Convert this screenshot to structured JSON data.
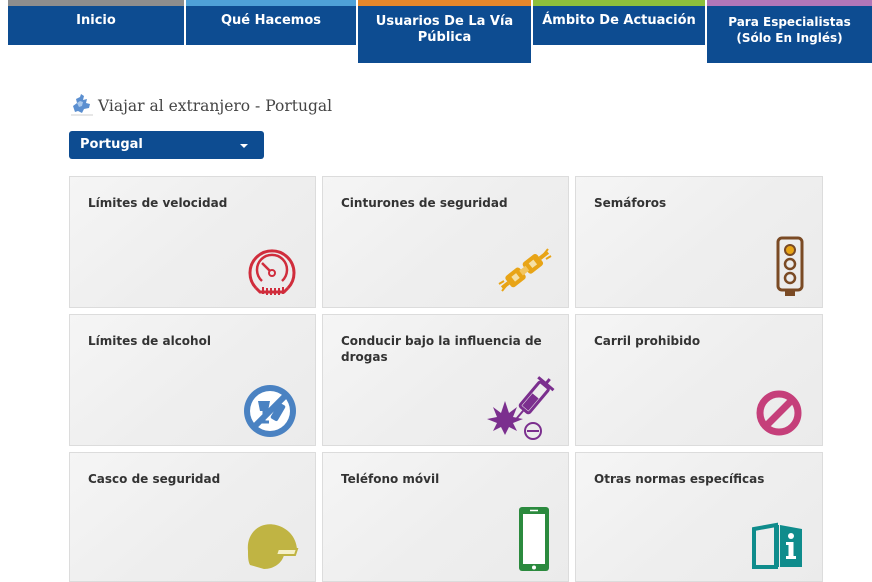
{
  "nav": {
    "tabs": [
      {
        "label": "Inicio",
        "stripe_color": "#8d8d8d"
      },
      {
        "label": "Qué Hacemos",
        "stripe_color": "#4ea1d8"
      },
      {
        "label": "Usuarios De La Vía Pública",
        "stripe_color": "#e5872b"
      },
      {
        "label": "Ámbito De Actuación",
        "stripe_color": "#8dbf3c"
      },
      {
        "label": "Para Especialistas (Sólo En Inglés)",
        "stripe_color": "#b276b8"
      }
    ]
  },
  "heading": {
    "text": "Viajar al extranjero - Portugal",
    "icon": "europe-map-icon"
  },
  "country_select": {
    "value": "Portugal"
  },
  "tiles": [
    {
      "title": "Límites de velocidad",
      "icon": "speedometer-icon",
      "color": "#d02d3c"
    },
    {
      "title": "Cinturones de seguridad",
      "icon": "seatbelt-buckle-icon",
      "color": "#e8a416"
    },
    {
      "title": "Semáforos",
      "icon": "traffic-light-icon",
      "color": "#7a4a24"
    },
    {
      "title": "Límites de alcohol",
      "icon": "no-alcohol-icon",
      "color": "#4a82c2"
    },
    {
      "title": "Conducir bajo la influencia de drogas",
      "icon": "drugs-syringe-icon",
      "color": "#7b2f8e"
    },
    {
      "title": "Carril prohibido",
      "icon": "prohibited-icon",
      "color": "#c53f7a"
    },
    {
      "title": "Casco de seguridad",
      "icon": "helmet-icon",
      "color": "#c0b443"
    },
    {
      "title": "Teléfono móvil",
      "icon": "mobile-phone-icon",
      "color": "#2b8a3e"
    },
    {
      "title": "Otras normas específicas",
      "icon": "info-book-icon",
      "color": "#0f8c8c"
    }
  ]
}
